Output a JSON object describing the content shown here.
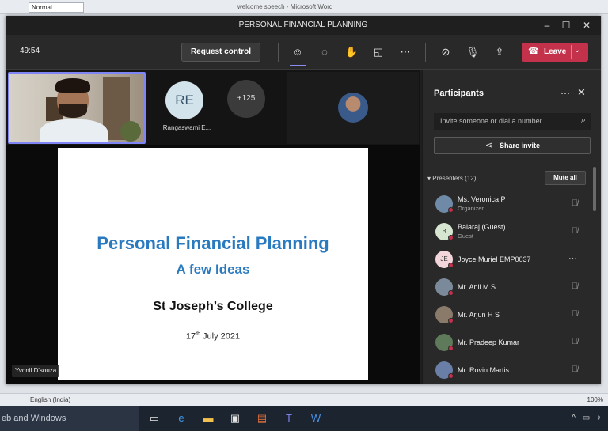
{
  "word": {
    "style_box": "Normal",
    "title": "welcome speech - Microsoft Word",
    "status_lang": "English (India)",
    "zoom": "100%"
  },
  "taskbar": {
    "search_text": "eb and Windows"
  },
  "teams": {
    "title": "PERSONAL FINANCIAL PLANNING",
    "timer": "49:54",
    "request_control": "Request control",
    "leave": "Leave"
  },
  "stage": {
    "tile_initials": "RE",
    "tile_name": "Rangaswami E...",
    "more_count": "+125",
    "presenter_name": "Yvonil D'souza"
  },
  "slide": {
    "title": "Personal Financial Planning",
    "subtitle": "A few Ideas",
    "college": "St Joseph’s College",
    "date_day": "17",
    "date_suffix": "th",
    "date_rest": " July 2021"
  },
  "panel": {
    "heading": "Participants",
    "search_placeholder": "Invite someone or dial a number",
    "share_invite": "Share invite",
    "section_label": "Presenters (12)",
    "mute_all": "Mute all",
    "participants": [
      {
        "name": "Ms. Veronica P",
        "role": "Organizer",
        "initials": "",
        "avatar_color": "#6f8aa6"
      },
      {
        "name": "Balaraj (Guest)",
        "role": "Guest",
        "initials": "B",
        "avatar_color": "#d7e6d0"
      },
      {
        "name": "Joyce Muriel EMP0037",
        "role": "",
        "initials": "JE",
        "avatar_color": "#f2d6dc"
      },
      {
        "name": "Mr. Anil M S",
        "role": "",
        "initials": "",
        "avatar_color": "#7b8a9a"
      },
      {
        "name": "Mr. Arjun H S",
        "role": "",
        "initials": "",
        "avatar_color": "#8a7a6a"
      },
      {
        "name": "Mr. Pradeep Kumar",
        "role": "",
        "initials": "",
        "avatar_color": "#5f7a5a"
      },
      {
        "name": "Mr. Rovin Martis",
        "role": "",
        "initials": "",
        "avatar_color": "#6a7fa8"
      }
    ]
  }
}
